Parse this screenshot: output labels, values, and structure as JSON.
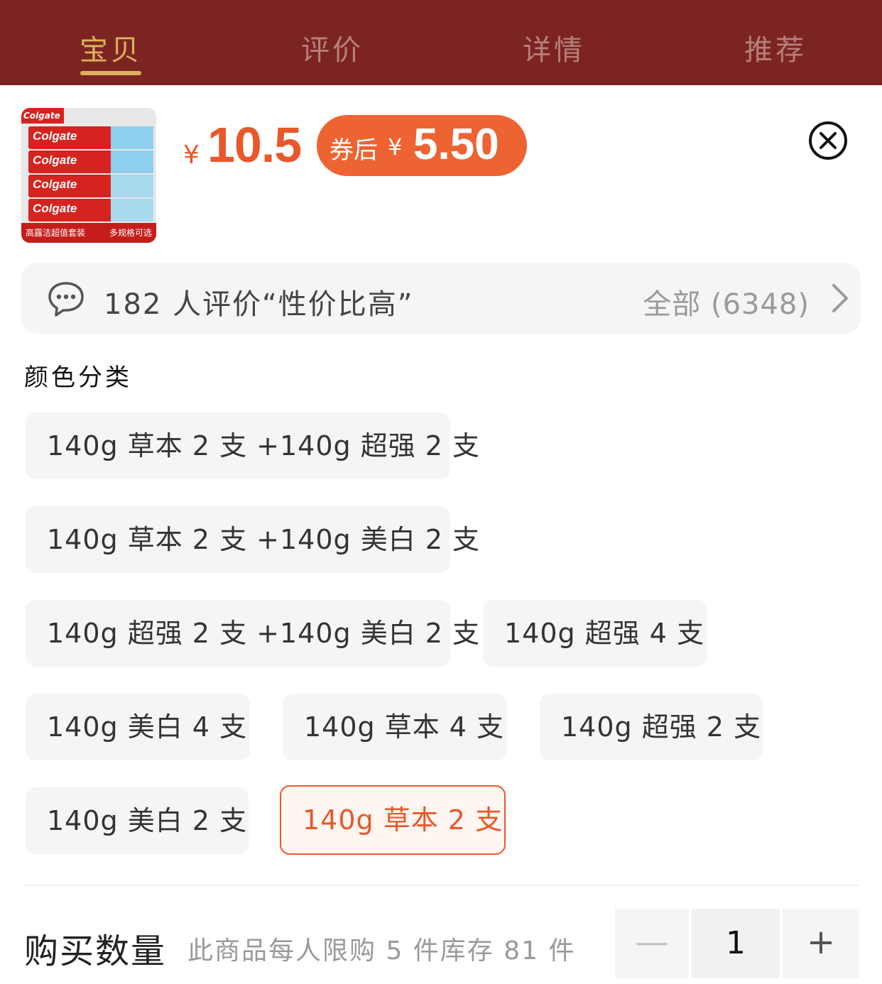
{
  "tabs": [
    {
      "label": "宝贝",
      "active": true
    },
    {
      "label": "评价",
      "active": false
    },
    {
      "label": "详情",
      "active": false
    },
    {
      "label": "推荐",
      "active": false
    }
  ],
  "product": {
    "thumb_brand": "Colgate",
    "thumb_caption_left": "高露洁超值套装",
    "thumb_caption_right": "多规格可选",
    "currency": "¥",
    "price": "10.5",
    "coupon_label": "券后",
    "coupon_currency": "¥",
    "coupon_price": "5.50"
  },
  "review": {
    "summary": "182 人评价“性价比高”",
    "all_label": "全部 (6348)"
  },
  "section_title": "颜色分类",
  "options": [
    {
      "label": "140g 草本 2 支 +140g 超强 2 支",
      "selected": false
    },
    {
      "label": "140g 草本 2 支 +140g 美白 2 支",
      "selected": false
    },
    {
      "label": "140g 超强 2 支 +140g 美白 2 支",
      "selected": false
    },
    {
      "label": "140g 超强 4 支",
      "selected": false
    },
    {
      "label": "140g 美白 4 支",
      "selected": false
    },
    {
      "label": "140g 草本 4 支",
      "selected": false
    },
    {
      "label": "140g 超强 2 支",
      "selected": false
    },
    {
      "label": "140g 美白 2 支",
      "selected": false
    },
    {
      "label": "140g 草本 2 支",
      "selected": true
    }
  ],
  "quantity": {
    "title": "购买数量",
    "note": "此商品每人限购 5 件库存 81 件",
    "minus": "—",
    "value": "1",
    "plus": "+"
  },
  "colors": {
    "topbar": "#7c2422",
    "accent": "#e8582a",
    "tab_active": "#d9b25a"
  }
}
